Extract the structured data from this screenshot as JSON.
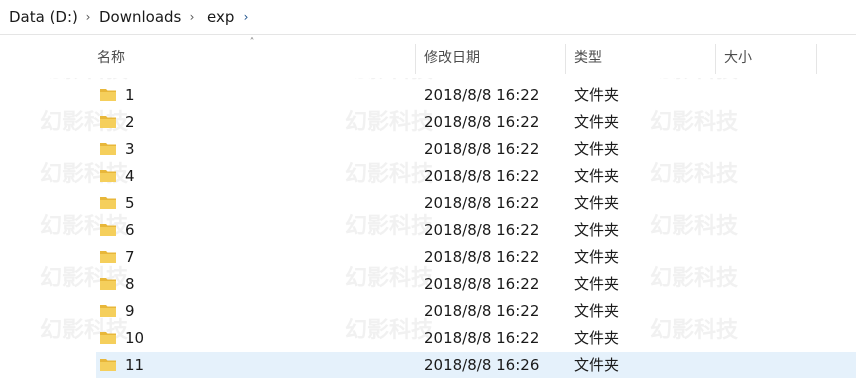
{
  "breadcrumb": {
    "items": [
      "Data (D:)",
      "Downloads",
      "exp"
    ]
  },
  "columns": {
    "name": "名称",
    "date": "修改日期",
    "type": "类型",
    "size": "大小"
  },
  "rows": [
    {
      "name": "1",
      "date": "2018/8/8 16:22",
      "type": "文件夹"
    },
    {
      "name": "2",
      "date": "2018/8/8 16:22",
      "type": "文件夹"
    },
    {
      "name": "3",
      "date": "2018/8/8 16:22",
      "type": "文件夹"
    },
    {
      "name": "4",
      "date": "2018/8/8 16:22",
      "type": "文件夹"
    },
    {
      "name": "5",
      "date": "2018/8/8 16:22",
      "type": "文件夹"
    },
    {
      "name": "6",
      "date": "2018/8/8 16:22",
      "type": "文件夹"
    },
    {
      "name": "7",
      "date": "2018/8/8 16:22",
      "type": "文件夹"
    },
    {
      "name": "8",
      "date": "2018/8/8 16:22",
      "type": "文件夹"
    },
    {
      "name": "9",
      "date": "2018/8/8 16:22",
      "type": "文件夹"
    },
    {
      "name": "10",
      "date": "2018/8/8 16:22",
      "type": "文件夹"
    },
    {
      "name": "11",
      "date": "2018/8/8 16:26",
      "type": "文件夹"
    }
  ],
  "selected_row": 10,
  "watermark": "幻影科技",
  "colors": {
    "selection": "#e5f1fb",
    "folder": "#f0c54d"
  }
}
